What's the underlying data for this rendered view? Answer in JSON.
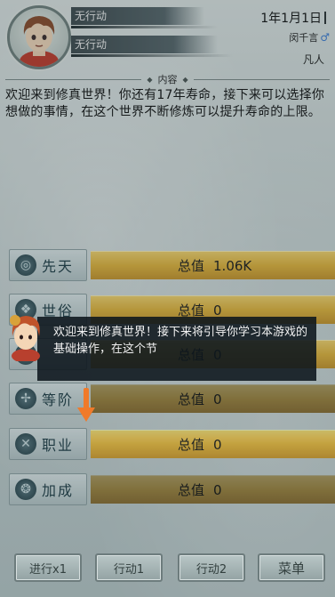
{
  "header": {
    "action_top": "无行动",
    "action_bottom": "无行动",
    "date": "1年1月1日",
    "character_name": "闵千言",
    "rank": "凡人"
  },
  "content": {
    "title": "内容",
    "story": "欢迎来到修真世界！你还有17年寿命，接下来可以选择你想做的事情，在这个世界不断修炼可以提升寿命的上限。"
  },
  "attributes": [
    {
      "label": "先天",
      "value_label": "总值",
      "value": "1.06K",
      "icon": "innate-icon"
    },
    {
      "label": "世俗",
      "value_label": "总值",
      "value": "0",
      "icon": "secular-icon"
    },
    {
      "label": "",
      "value_label": "总值",
      "value": "0",
      "icon": "hidden-icon"
    },
    {
      "label": "等阶",
      "value_label": "总值",
      "value": "0",
      "icon": "rank-icon"
    },
    {
      "label": "职业",
      "value_label": "总值",
      "value": "0",
      "icon": "profession-icon"
    },
    {
      "label": "加成",
      "value_label": "总值",
      "value": "0",
      "icon": "bonus-icon"
    }
  ],
  "tutorial": {
    "text": "欢迎来到修真世界！接下来将引导你学习本游戏的基础操作，在这个节"
  },
  "buttons": {
    "run": "进行x1",
    "action1": "行动1",
    "action2": "行动2",
    "menu": "菜单"
  },
  "colors": {
    "gold_bar": "#e4b53a",
    "arrow": "#f07a2a",
    "tutorial_bg": "#0c161c"
  }
}
